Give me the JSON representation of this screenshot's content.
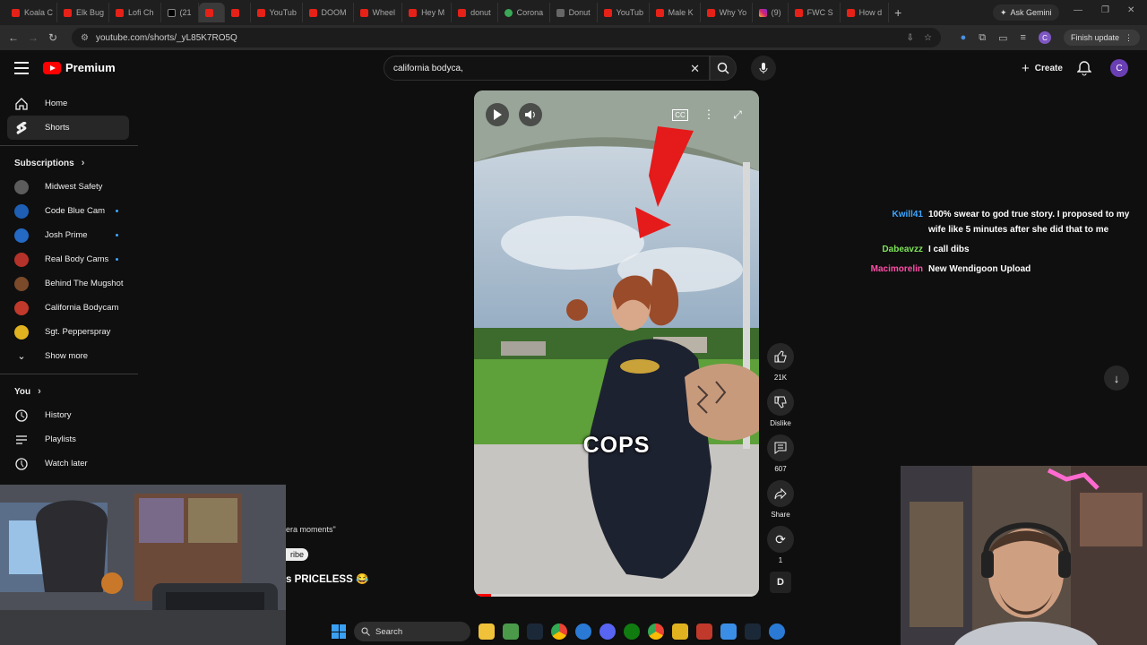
{
  "browser": {
    "tabs": [
      {
        "label": "Koala C",
        "icon": "youtube-icon"
      },
      {
        "label": "Elk Bug",
        "icon": "youtube-icon"
      },
      {
        "label": "Lofi Ch",
        "icon": "youtube-icon"
      },
      {
        "label": "(21",
        "icon": "x-icon"
      },
      {
        "label": "",
        "icon": "youtube-icon"
      },
      {
        "label": "",
        "icon": "youtube-icon"
      },
      {
        "label": "YouTub",
        "icon": "youtube-icon"
      },
      {
        "label": "DOOM",
        "icon": "youtube-icon"
      },
      {
        "label": "Wheel",
        "icon": "youtube-icon"
      },
      {
        "label": "Hey M",
        "icon": "youtube-icon"
      },
      {
        "label": "donut",
        "icon": "youtube-icon"
      },
      {
        "label": "Corona",
        "icon": "maps-icon"
      },
      {
        "label": "Donut",
        "icon": "web-icon"
      },
      {
        "label": "YouTub",
        "icon": "youtube-icon"
      },
      {
        "label": "Male K",
        "icon": "youtube-icon"
      },
      {
        "label": "Why Yo",
        "icon": "youtube-icon"
      },
      {
        "label": "(9)",
        "icon": "instagram-icon"
      },
      {
        "label": "FWC S",
        "icon": "youtube-icon"
      },
      {
        "label": "How d",
        "icon": "youtube-icon"
      }
    ],
    "new_tab": "+",
    "ask_gemini": "Ask Gemini",
    "url": "youtube.com/shorts/_yL85K7RO5Q",
    "finish_update": "Finish update",
    "profile_initial": "C"
  },
  "youtube": {
    "logo_text": "Premium",
    "search_value": "california bodyca,",
    "create_label": "Create",
    "avatar_initial": "C"
  },
  "sidebar": {
    "main": [
      {
        "label": "Home",
        "icon": "home-icon"
      },
      {
        "label": "Shorts",
        "icon": "shorts-icon",
        "active": true
      }
    ],
    "subscriptions_label": "Subscriptions",
    "subscriptions": [
      {
        "label": "Midwest Safety",
        "color": "#5c5c5c",
        "live": false
      },
      {
        "label": "Code Blue Cam",
        "color": "#1e5fb5",
        "live": true
      },
      {
        "label": "Josh Prime",
        "color": "#2469c4",
        "live": true
      },
      {
        "label": "Real Body Cams",
        "color": "#b5322a",
        "live": true
      },
      {
        "label": "Behind The Mugshot",
        "color": "#7a4a2a",
        "live": false
      },
      {
        "label": "California Bodycam",
        "color": "#c0392b",
        "live": false
      },
      {
        "label": "Sgt. Pepperspray",
        "color": "#e0b21f",
        "live": false
      }
    ],
    "show_more": "Show more",
    "you_label": "You",
    "you_items": [
      {
        "label": "History",
        "icon": "history-icon"
      },
      {
        "label": "Playlists",
        "icon": "playlists-icon"
      },
      {
        "label": "Watch later",
        "icon": "watch-later-icon"
      }
    ]
  },
  "short": {
    "caption": "COPS",
    "progress": 0.06,
    "likes": "21K",
    "dislike_label": "Dislike",
    "comments": "607",
    "share_label": "Share",
    "remix_count": "1",
    "channel_badge": "D"
  },
  "overlay_text": {
    "partial_quote": "era moments\"",
    "partial_button": "ribe",
    "partial_title": "s PRICELESS 😂"
  },
  "chat": [
    {
      "user": "Kwill41",
      "color": "#3ea6ff",
      "text": "100% swear to god true story. I proposed to my wife like 5 minutes after she did that to me"
    },
    {
      "user": "Dabeavzz",
      "color": "#7ee35a",
      "text": "I call dibs"
    },
    {
      "user": "Macimorelin",
      "color": "#ff4fa8",
      "text": "New Wendigoon Upload"
    }
  ],
  "taskbar": {
    "search_label": "Search"
  }
}
